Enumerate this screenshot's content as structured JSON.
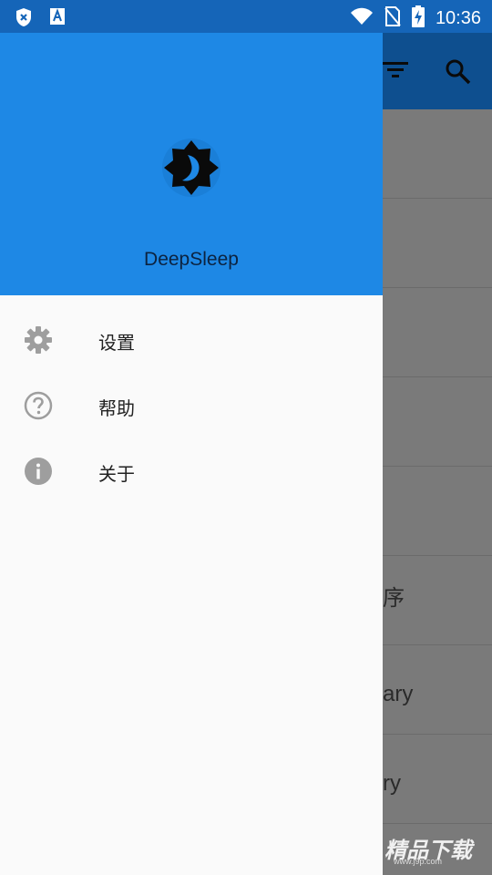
{
  "status_bar": {
    "time": "10:36",
    "icons": [
      "shield-x-icon",
      "font-a-icon",
      "wifi-icon",
      "no-sim-icon",
      "battery-charging-icon"
    ]
  },
  "background_app": {
    "toolbar_icons": [
      "filter-icon",
      "search-icon"
    ],
    "list_fragments": [
      "",
      "",
      "",
      "",
      "",
      "序",
      "ary",
      "ry"
    ]
  },
  "watermark": {
    "text": "精品下载",
    "sub": "www.j9p.com"
  },
  "drawer": {
    "header": {
      "app_name": "DeepSleep",
      "logo_icon": "brightness-moon-icon",
      "background_color": "#1e88e5"
    },
    "menu": [
      {
        "label": "设置",
        "icon": "gear-icon"
      },
      {
        "label": "帮助",
        "icon": "help-circle-icon"
      },
      {
        "label": "关于",
        "icon": "info-icon"
      }
    ]
  }
}
